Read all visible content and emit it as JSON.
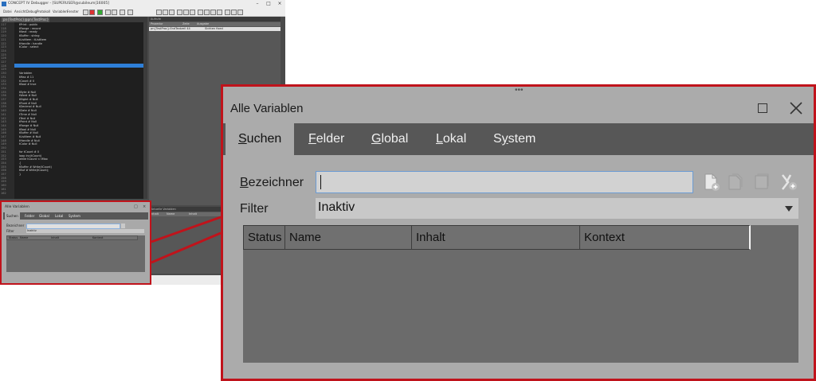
{
  "background_window": {
    "title": "CONCEPT IV Debugger - [SUPERUSER@cubileum|16005]",
    "menu": [
      "Datei",
      "Ansicht",
      "Debug",
      "Protokoll",
      "Variablen",
      "Fenster"
    ],
    "editor_tab": "pn{TestProc}@pn{TestProc}",
    "line_numbers": [
      "117",
      "118",
      "119",
      "120",
      "121",
      "122",
      "123",
      "124",
      "125",
      "126",
      "127",
      "128",
      "129",
      "130",
      "131",
      "132",
      "133",
      "134",
      "135",
      "136",
      "137",
      "138",
      "139",
      "140",
      "141",
      "142",
      "143",
      "144",
      "145",
      "146",
      "147",
      "148",
      "149",
      "150",
      "151",
      "152",
      "153",
      "154",
      "155",
      "156",
      "157",
      "158",
      "159",
      "160",
      "161",
      "162"
    ],
    "code_lines": [
      "tPrint : public",
      "tRange : record",
      "tNext : ready",
      "tBuffer : string",
      "tListItem : tListItem",
      "tHandle : handle",
      "tColor : select",
      "",
      "",
      "",
      "",
      "",
      "",
      "Variablen",
      "tMax # 11",
      "tCount # 0",
      "tBool # true",
      "",
      "tByte # Null",
      "tWord # Null",
      "tBigInt # Null",
      "tFloat # Null",
      "tDecimal # Null",
      "tDate # Null",
      "tTime # Null",
      "tText # Null",
      "tPoint # Null",
      "tRange # Null",
      "tBool # Null",
      "tBuffer # Null",
      "tListItem # Null",
      "tHandle # Null",
      "tColor # Null",
      "",
      "for tCount # 0",
      "loop inc(tCount)",
      "while tCount < tMax",
      "{",
      "  tBuffer # Write(tCount)",
      "  tBuf # Write(tCount);",
      "}",
      "",
      "",
      "",
      "",
      ""
    ],
    "right_panel_title": "Aufrufe",
    "right_panel_columns": [
      "Prozedur",
      "Zeile",
      "Ausgabe"
    ],
    "right_panel_row": [
      "pn{TestProc}:EndTextzeil 44",
      "",
      "Sichten fixed"
    ],
    "lower_panel_title": "Aktuelle Variablen",
    "lower_panel_columns": [
      "Inhalt",
      "Name",
      "Inhalt"
    ]
  },
  "mini_dialog": {
    "title": "Alle Variablen",
    "tabs": [
      "Suchen",
      "Felder",
      "Global",
      "Lokal",
      "System"
    ],
    "label_name": "Bezeichner",
    "label_filter": "Filter",
    "filter_value": "Inaktiv",
    "columns": [
      "Status",
      "Name",
      "Inhalt",
      "Kontext"
    ]
  },
  "dialog": {
    "title": "Alle Variablen",
    "tabs": [
      {
        "label": "Suchen",
        "accel": "S",
        "rest": "uchen",
        "active": true
      },
      {
        "label": "Felder",
        "accel": "F",
        "rest": "elder",
        "active": false
      },
      {
        "label": "Global",
        "accel": "G",
        "rest": "lobal",
        "active": false
      },
      {
        "label": "Lokal",
        "accel": "L",
        "rest": "okal",
        "active": false
      },
      {
        "label": "System",
        "pre": "S",
        "accel": "y",
        "rest": "stem",
        "active": false
      }
    ],
    "label_name_accel": "B",
    "label_name_rest": "ezeichner",
    "name_value": "",
    "label_filter": "Filter",
    "filter_value": "Inaktiv",
    "toolbar": [
      "add-variable-icon",
      "copy-variable-icon",
      "remove-variable-icon",
      "add-watch-icon"
    ],
    "columns": [
      "Status",
      "Name",
      "Inhalt",
      "Kontext"
    ]
  },
  "colors": {
    "highlight_border": "#c0131b",
    "dialog_bg": "#ababab",
    "tabbar_bg": "#575757",
    "grid_bg": "#6b6b6b",
    "editor_bg": "#1f1f1f",
    "selection": "#2e7fd8"
  }
}
